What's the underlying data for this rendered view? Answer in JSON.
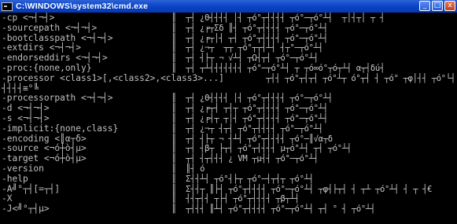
{
  "window": {
    "title": "C:\\WINDOWS\\system32\\cmd.exe",
    "minimize": "_",
    "maximize": "□",
    "close": "x"
  },
  "console": {
    "options": [
      "-cp <¬┤¬┤>",
      "-sourcepath <¬┤¬┤>",
      "-bootclasspath <¬┤¬┤>",
      "-extdirs <¬┤¬┤>",
      "-endorseddirs <¬┤¬┤>",
      "-proc:{none,only}",
      "-processor <class1>[,<class2>,<class3>...]",
      "┤┤┤┤≡°╚",
      "-processorpath <¬┤¬┤>",
      "-d <¬┤¬┤>",
      "-s <¬┤¬┤>",
      "-implicit:{none,class}",
      "-encoding <║α┬δ>",
      "-source <¬ó┼ò┤µ>",
      "-target <¬ó┼ò┤µ>",
      "-version",
      "-help",
      "-A╝°┬┤[=┬┤]",
      "-X",
      "-J<╝°┬┤µ>"
    ],
    "garbled": [
      "║  ┬┤ ¿Θ┤┤┤┤ │┤ ┬ó°┬┤┤┤┤ ┬ó°─┬ó°┴┤  ┬│┤┬│ ┬ ┤",
      "║  ┬┤ ¿╒┬Σδ ║┤ ┬ó°┬┤┤┤┤ ┬ó°─┬ó°┴┤",
      "║  ┬┤ ¿╒┬│┤ ┬┤ ┬ó°┬┤┤┤┤ ┬ó°─┬ó°┴┤",
      "║  ┬┤ ¿¬┬  ┬┬ ┬ó°┬┬┤┴┤ ┤┬°─┬ó°┴┤",
      "║  ┬┤ ┤├┬ ¬ √┴┤ ┬Ω┤┬┤ ┬ó°─┬ó°┴┤",
      "║  ┬┤ ┬┴┤┤┤┤┤┤┤ ┬ó°─┬ó°┴┤ ┬ ┬ó∞ó°┬ó┬┴┤ α┬┤δú┤",
      "┬┤┤ ┬ó°┬┤┬┤ ┬ó°┴┬ ó°┬┤ ┤ ┬ó° ┬φ│┤┤ ┬ó°└┤ ┴ ┬  ╘┤  ┤└┤  ╘┬┤┬┤┴  ╘┤≡°─┬",
      "",
      "║  ┬┤ ¿Θ┤┤┤┤ │┤ ┬ó°┬┤┤┤┤ ┬ó°─┬ó°┴┤",
      "║  ┬┤ ¿╒┬┤ ┬┤┬ ┬ó°┬┤┤┤┤ ┬ó°─┬ó°┴┤",
      "║  ┬┤ ¿╒┤┬ ┬│┤ ┬ó°┬┤┤┤┤ ┬ó°─┬ó°┴┤",
      "║  ┬┤ ¿¬┬ ┤┬┤ ┬ó°┬┤┤┤┤ ┬ó°─┬ó°┴┤",
      "║  ┬┤ ┤├┬ ¬ ┤┴┤ ┬ó°┬┤┤┤┤ ┬ó°─║√α┬δ",
      "║  ┬┤ ┤β┬ ├┬┤ ┬ó°┬┤┤┤┤ µ┬ó°┴┤ ┬┤ ┬ó°┴┤",
      "║  ┬┤ ┤┬┤┤┤ ¿ VM ┬µ┤┤ ┬ó°─┬ó°┴┤",
      "║  ║┤ ó",
      "║  Σ┤┤┴┤ ┬ó°┤├┬ ┬ó°─┤┬┤┬ ┬ó°┴┤",
      "║  Σ┤┤┬ ║├┤ ┬ó°┬┤┤┤┤ ┬ó°─┬ó°┴┤ ┬φ┤├┬┤ ┤ ┬┴ ┬ó°┴┤ ┤ ┬ ┤€",
      "║  ┤┤┬┤┤ ┬├┤ ┬ó°┬┤┤┤┤ ┬β┬┴┤",
      "║  ┬┤┤┤ ║┴┤ ┬ó°┬┤┤┤┤ ┬ó°─┬ó°┴┤ ┬┤ ° ┤ ┬ó°┴┤"
    ]
  }
}
